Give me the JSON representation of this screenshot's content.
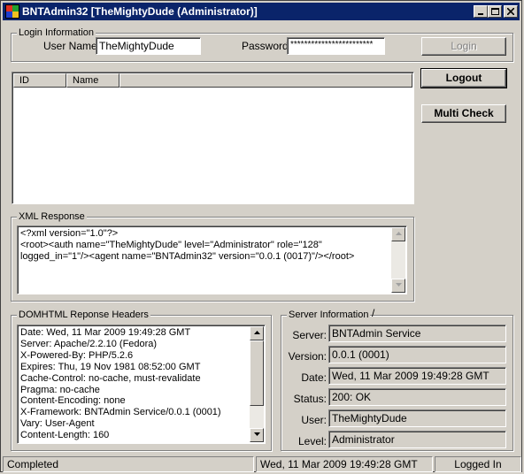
{
  "window": {
    "title": "BNTAdmin32 [TheMightyDude (Administrator)]",
    "app_icon": "app-window-icon",
    "caption_buttons": [
      "minimize",
      "maximize",
      "close"
    ]
  },
  "login": {
    "group_title": "Login Information",
    "username_label": "User Name:",
    "username_value": "TheMightyDude",
    "password_label": "Password:",
    "password_value": "************************",
    "login_button": "Login"
  },
  "users_list": {
    "columns": [
      "ID",
      "Name"
    ]
  },
  "actions": {
    "logout_button": "Logout",
    "multicheck_button": "Multi Check"
  },
  "xml_response": {
    "group_title": "XML Response",
    "lines": [
      "<?xml version=\"1.0\"?>",
      "<root><auth name=\"TheMightyDude\" level=\"Administrator\" role=\"128\"",
      "logged_in=\"1\"/><agent name=\"BNTAdmin32\" version=\"0.0.1 (0017)\"/></root>"
    ]
  },
  "headers": {
    "group_title": "DOMHTML Reponse Headers",
    "lines": [
      "Date: Wed, 11 Mar 2009 19:49:28 GMT",
      "Server: Apache/2.2.10 (Fedora)",
      "X-Powered-By: PHP/5.2.6",
      "Expires: Thu, 19 Nov 1981 08:52:00 GMT",
      "Cache-Control: no-cache, must-revalidate",
      "Pragma: no-cache",
      "Content-Encoding: none",
      "X-Framework: BNTAdmin Service/0.0.1 (0001)",
      "Vary: User-Agent",
      "Content-Length: 160"
    ]
  },
  "server_info": {
    "group_title": "Server Information",
    "title_mark": "/",
    "fields": [
      {
        "label": "Server:",
        "value": "BNTAdmin Service"
      },
      {
        "label": "Version:",
        "value": "0.0.1 (0001)"
      },
      {
        "label": "Date:",
        "value": "Wed, 11 Mar 2009 19:49:28 GMT"
      },
      {
        "label": "Status:",
        "value": "200: OK"
      },
      {
        "label": "User:",
        "value": "TheMightyDude"
      },
      {
        "label": "Level:",
        "value": "Administrator"
      }
    ]
  },
  "statusbar": {
    "status": "Completed",
    "datetime": "Wed, 11 Mar 2009 19:49:28 GMT",
    "login_state": "Logged In"
  }
}
